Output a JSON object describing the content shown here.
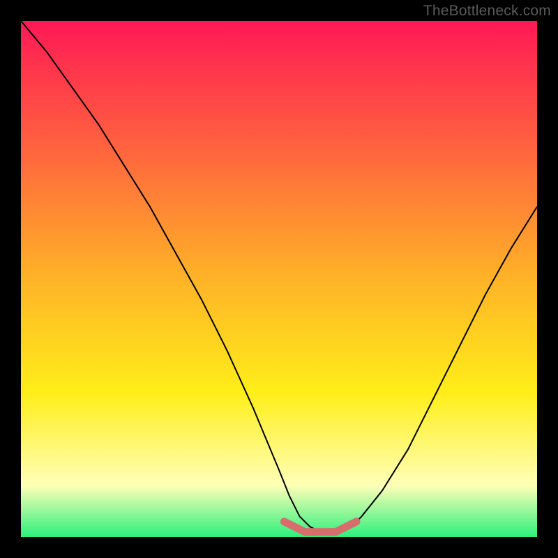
{
  "watermark": "TheBottleneck.com",
  "colors": {
    "frame": "#000000",
    "watermark": "#5a5a5a",
    "gradient_top": "#ff1955",
    "gradient_upper": "#ff5b41",
    "gradient_mid": "#ffb327",
    "gradient_low": "#ffee19",
    "gradient_pale": "#ffffb7",
    "gradient_bottom": "#2cf07d",
    "curve": "#000000",
    "marker": "#d96c6c"
  },
  "chart_data": {
    "type": "line",
    "title": "",
    "xlabel": "",
    "ylabel": "",
    "xlim": [
      0,
      100
    ],
    "ylim": [
      0,
      100
    ],
    "series": [
      {
        "name": "bottleneck-curve",
        "x": [
          0,
          5,
          10,
          15,
          20,
          25,
          30,
          35,
          40,
          45,
          50,
          52,
          54,
          56,
          58,
          60,
          62,
          64,
          66,
          70,
          75,
          80,
          85,
          90,
          95,
          100
        ],
        "y": [
          100,
          94,
          87,
          80,
          72,
          64,
          55,
          46,
          36,
          25,
          13,
          8,
          4,
          2,
          1,
          1,
          1,
          2,
          4,
          9,
          17,
          27,
          37,
          47,
          56,
          64
        ]
      },
      {
        "name": "optimal-band",
        "x": [
          51,
          53,
          55,
          57,
          59,
          61,
          63,
          65
        ],
        "y": [
          3,
          2,
          1,
          1,
          1,
          1,
          2,
          3
        ]
      }
    ],
    "gradient_stops_percent_from_top": [
      {
        "pct": 0,
        "key": "gradient_top"
      },
      {
        "pct": 22,
        "key": "gradient_upper"
      },
      {
        "pct": 50,
        "key": "gradient_mid"
      },
      {
        "pct": 72,
        "key": "gradient_low"
      },
      {
        "pct": 90,
        "key": "gradient_pale"
      },
      {
        "pct": 100,
        "key": "gradient_bottom"
      }
    ]
  }
}
